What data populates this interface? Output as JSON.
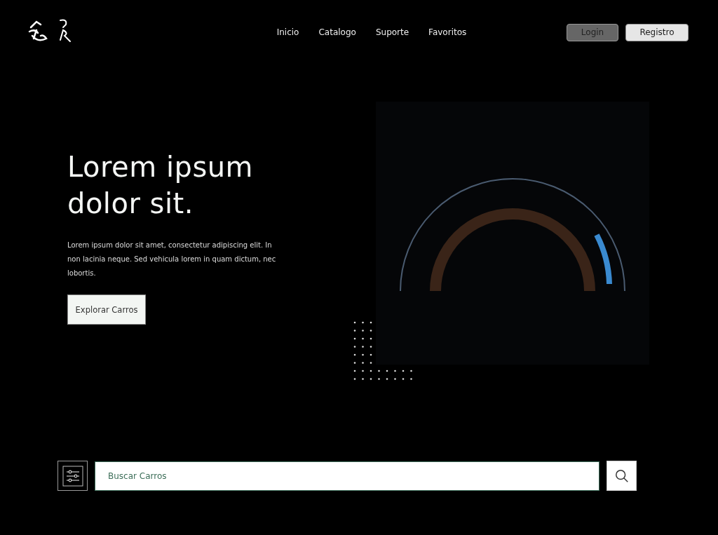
{
  "nav": {
    "links": [
      {
        "label": "Inicio"
      },
      {
        "label": "Catalogo"
      },
      {
        "label": "Suporte"
      },
      {
        "label": "Favoritos"
      }
    ],
    "buttons": [
      {
        "label": "Login",
        "kind": "dark"
      },
      {
        "label": "Registro",
        "kind": "light"
      }
    ]
  },
  "hero": {
    "title": "Lorem ipsum dolor sit.",
    "text": "Lorem ipsum dolor sit amet, consectetur adipiscing elit. In non lacinia neque. Sed vehicula lorem in quam dictum, nec lobortis.",
    "cta": "Explorar Carros"
  },
  "search": {
    "placeholder": "Buscar Carros"
  }
}
